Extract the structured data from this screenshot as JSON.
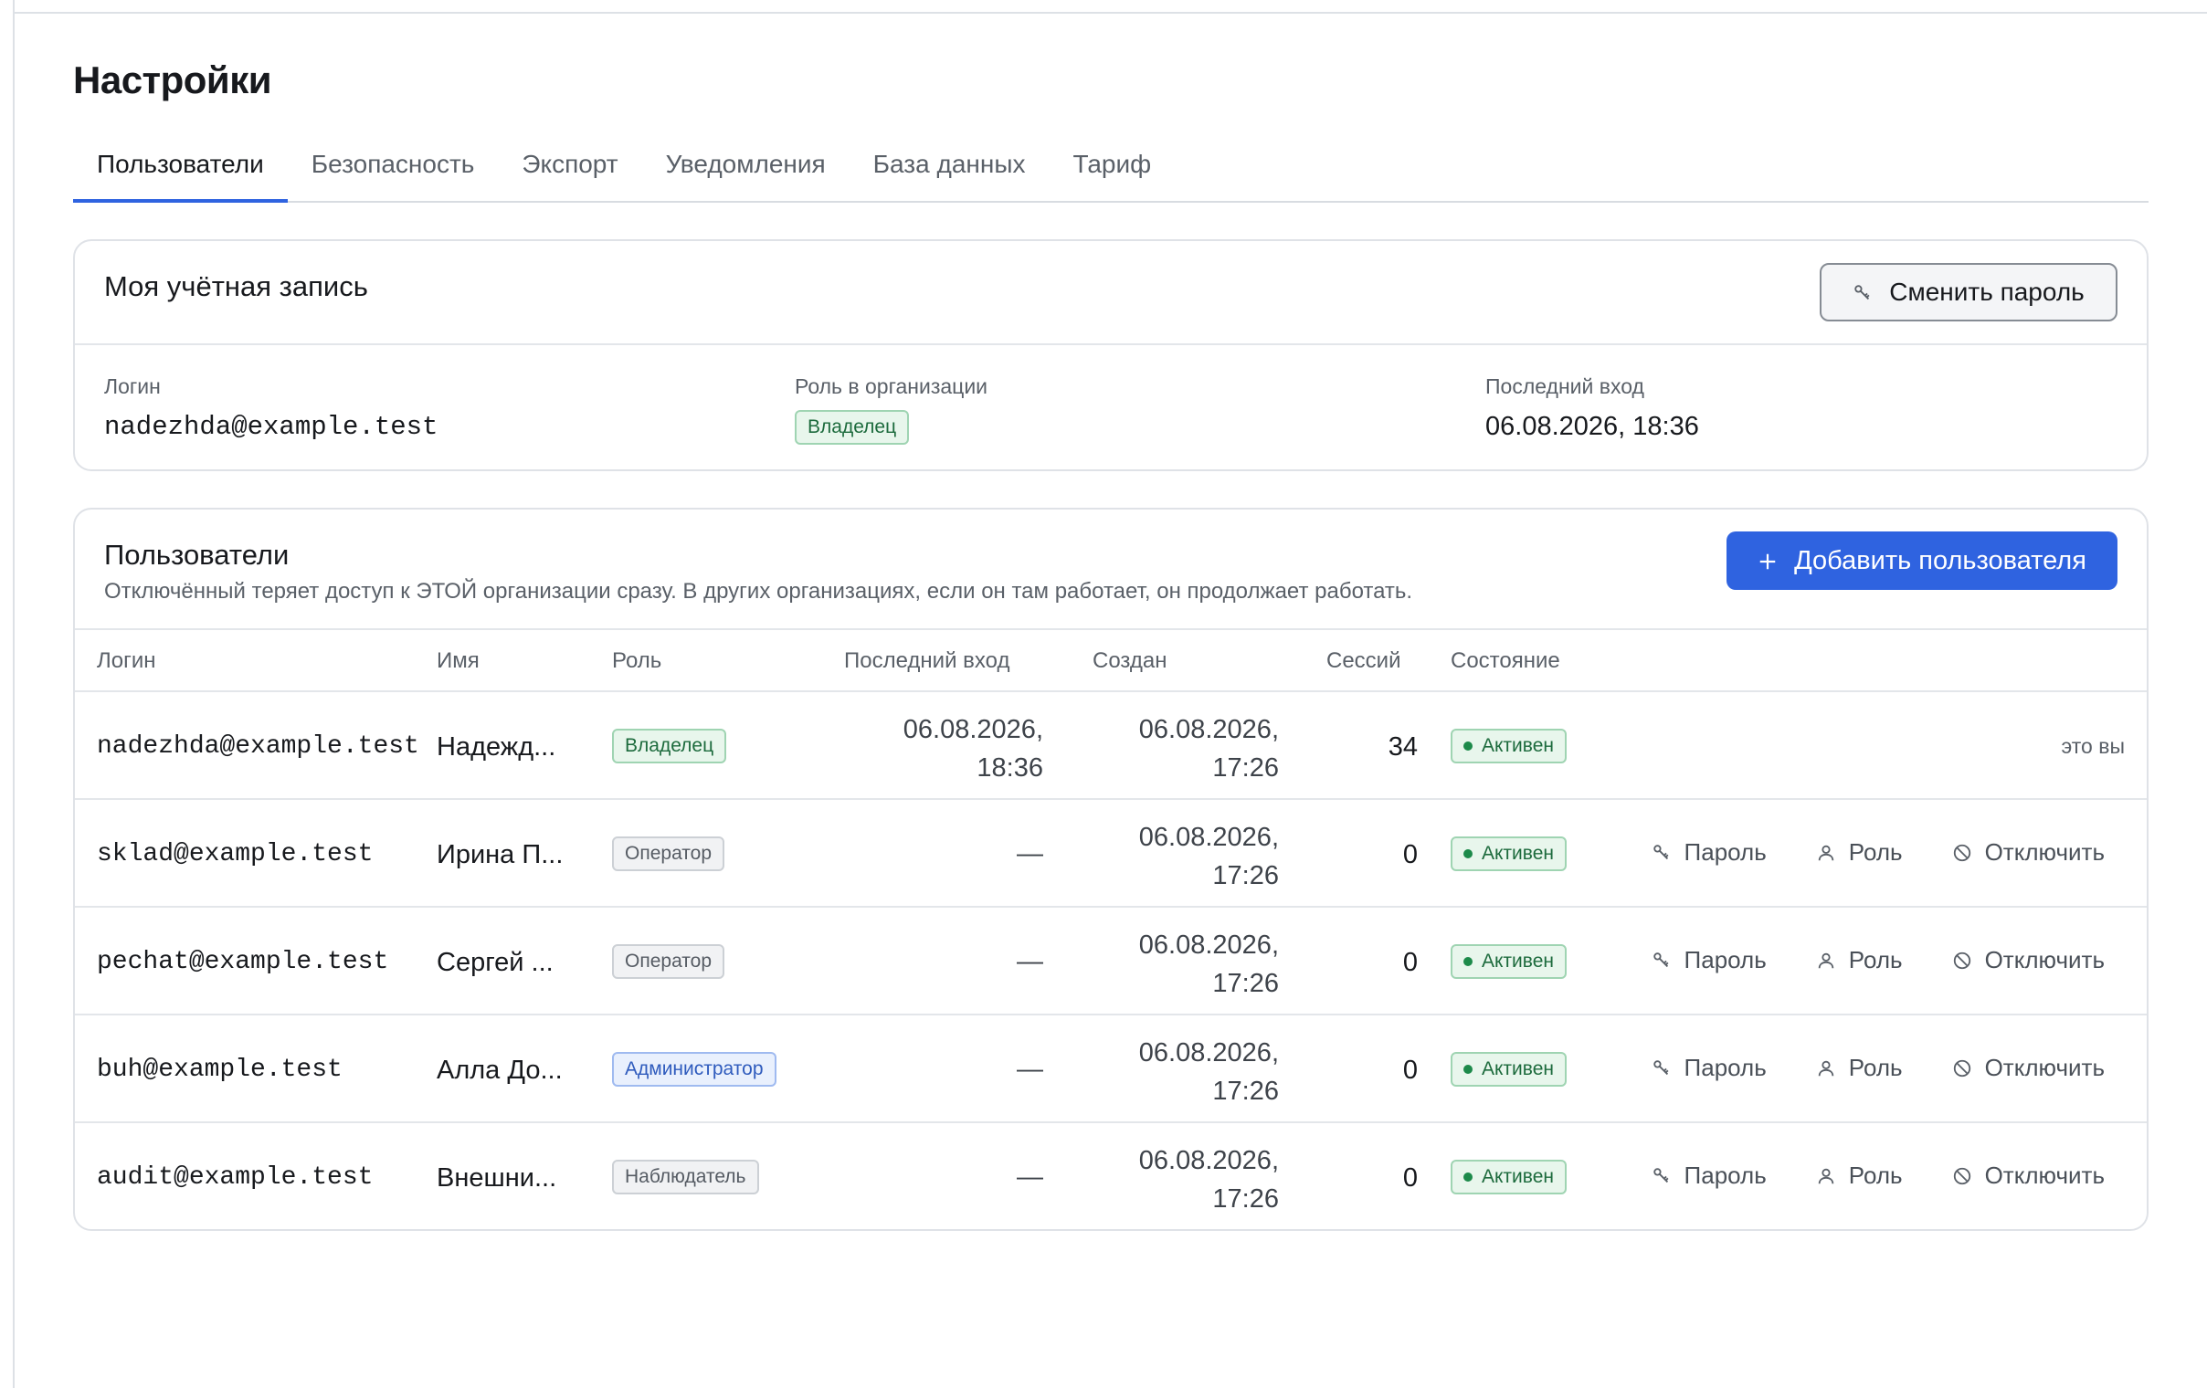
{
  "page": {
    "title": "Настройки"
  },
  "tabs": [
    {
      "label": "Пользователи",
      "active": true
    },
    {
      "label": "Безопасность"
    },
    {
      "label": "Экспорт"
    },
    {
      "label": "Уведомления"
    },
    {
      "label": "База данных"
    },
    {
      "label": "Тариф"
    }
  ],
  "account": {
    "title": "Моя учётная запись",
    "change_password_label": "Сменить пароль",
    "login_label": "Логин",
    "login_value": "nadezhda@example.test",
    "role_label": "Роль в организации",
    "role_value": "Владелец",
    "last_login_label": "Последний вход",
    "last_login_value": "06.08.2026, 18:36"
  },
  "users": {
    "title": "Пользователи",
    "subtitle": "Отключённый теряет доступ к ЭТОЙ организации сразу. В других организациях, если он там работает, он продолжает работать.",
    "add_label": "Добавить пользователя",
    "columns": [
      "Логин",
      "Имя",
      "Роль",
      "Последний вход",
      "Создан",
      "Сессий",
      "Состояние"
    ],
    "rows": [
      {
        "login": "nadezhda@example.test",
        "name": "Надежд...",
        "role": "Владелец",
        "last_login_date": "06.08.2026,",
        "last_login_time": "18:36",
        "created_date": "06.08.2026,",
        "created_time": "17:26",
        "sessions": "34",
        "status": "Активен",
        "note": "это вы"
      },
      {
        "login": "sklad@example.test",
        "name": "Ирина П...",
        "role": "Оператор",
        "last_login_date": "—",
        "created_date": "06.08.2026,",
        "created_time": "17:26",
        "sessions": "0",
        "status": "Активен"
      },
      {
        "login": "pechat@example.test",
        "name": "Сергей ...",
        "role": "Оператор",
        "last_login_date": "—",
        "created_date": "06.08.2026,",
        "created_time": "17:26",
        "sessions": "0",
        "status": "Активен"
      },
      {
        "login": "buh@example.test",
        "name": "Алла До...",
        "role": "Администратор",
        "last_login_date": "—",
        "created_date": "06.08.2026,",
        "created_time": "17:26",
        "sessions": "0",
        "status": "Активен"
      },
      {
        "login": "audit@example.test",
        "name": "Внешни...",
        "role": "Наблюдатель",
        "last_login_date": "—",
        "created_date": "06.08.2026,",
        "created_time": "17:26",
        "sessions": "0",
        "status": "Активен"
      }
    ],
    "actions": {
      "password": "Пароль",
      "role": "Роль",
      "disable": "Отключить"
    }
  },
  "icons": {
    "key": "key-icon",
    "user": "user-icon",
    "ban": "ban-icon",
    "plus": "plus-icon"
  },
  "colors": {
    "accent": "#2f63e0",
    "success": "#1d6b3d"
  }
}
